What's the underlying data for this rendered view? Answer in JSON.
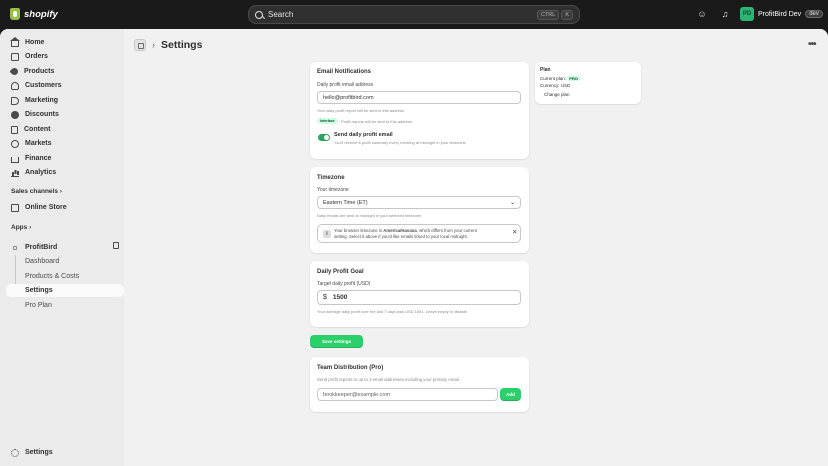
{
  "topbar": {
    "logo_text": "shopify",
    "search_placeholder": "Search",
    "kbd_ctrl": "CTRL",
    "kbd_k": "K",
    "store_name": "ProfitBird Dev",
    "store_initial": "PD",
    "dev_badge": "dev"
  },
  "sidebar": {
    "items": [
      {
        "label": "Home",
        "icon": "home-icon"
      },
      {
        "label": "Orders",
        "icon": "orders-icon"
      },
      {
        "label": "Products",
        "icon": "tag-icon"
      },
      {
        "label": "Customers",
        "icon": "person-icon"
      },
      {
        "label": "Marketing",
        "icon": "megaphone-icon"
      },
      {
        "label": "Discounts",
        "icon": "discount-icon"
      },
      {
        "label": "Content",
        "icon": "content-icon"
      },
      {
        "label": "Markets",
        "icon": "globe-icon"
      },
      {
        "label": "Finance",
        "icon": "bank-icon"
      },
      {
        "label": "Analytics",
        "icon": "analytics-icon"
      }
    ],
    "sales_channels_label": "Sales channels",
    "online_store_label": "Online Store",
    "apps_label": "Apps",
    "app_name": "ProfitBird",
    "app_sub_items": [
      "Dashboard",
      "Products & Costs",
      "Settings",
      "Pro Plan"
    ],
    "settings_label": "Settings"
  },
  "page": {
    "title": "Settings"
  },
  "email_card": {
    "title": "Email Notifications",
    "field_label": "Daily profit email address",
    "field_value": "hello@profitbird.com",
    "help": "Your daily profit report will be sent to this address",
    "pill": "Interface",
    "pill_help": "Profit reports will be sent to this address",
    "toggle_title": "Send daily profit email",
    "toggle_help": "You'll receive a profit summary every morning at midnight in your timezone",
    "toggle_on": true
  },
  "timezone_card": {
    "title": "Timezone",
    "field_label": "Your timezone",
    "selected": "Eastern Time (ET)",
    "help": "Daily emails are sent at midnight in your selected timezone",
    "banner_line1_prefix": "Your browser timezone is ",
    "banner_tz": "America/Havana",
    "banner_line1_suffix": ", which differs from your current",
    "banner_line2": "setting. Select it above if you'd like emails timed to your local midnight."
  },
  "goal_card": {
    "title": "Daily Profit Goal",
    "field_label": "Target daily profit (USD)",
    "currency": "$",
    "value": "1500",
    "help": "Your average daily profit over the last 7 days was USD 1681. Leave empty to disable."
  },
  "save_button": "Save settings",
  "team_card": {
    "title": "Team Distribution (Pro)",
    "help": "Send profit reports to up to 3 email addresses including your primary email.",
    "placeholder": "bookkeeper@example.com",
    "add_button": "Add"
  },
  "plan_card": {
    "title": "Plan",
    "current_plan_label": "Current plan:",
    "current_plan_value": "PRO",
    "currency_line": "Currency: USD",
    "change_plan": "Change plan"
  },
  "colors": {
    "accent_green": "#2bd06b",
    "toggle_green": "#2aa65c",
    "topbar": "#1a1a1a"
  }
}
